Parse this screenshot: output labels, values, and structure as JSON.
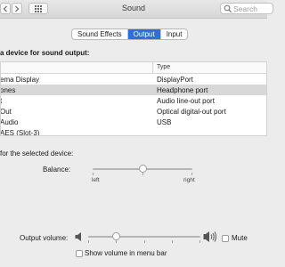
{
  "window": {
    "title": "Sound"
  },
  "search": {
    "placeholder": "Search"
  },
  "tabs": [
    {
      "label": "Sound Effects",
      "active": false
    },
    {
      "label": "Output",
      "active": true
    },
    {
      "label": "Input",
      "active": false
    }
  ],
  "device_section": {
    "label": "a device for sound output:"
  },
  "table": {
    "type_header": "Type",
    "rows": [
      {
        "name": "ema Display",
        "type": "DisplayPort"
      },
      {
        "name": "ones",
        "type": "Headphone port",
        "selected": true
      },
      {
        "name": "t",
        "type": "Audio line-out port"
      },
      {
        "name": "Out",
        "type": "Optical digital-out port"
      },
      {
        "name": "Audio",
        "type": "USB"
      },
      {
        "name": "AES (Slot-3)",
        "type": ""
      }
    ]
  },
  "settings": {
    "label": "for the selected device:"
  },
  "balance": {
    "label": "Balance:",
    "left_label": "left",
    "right_label": "right",
    "value": 0.5
  },
  "output_volume": {
    "label": "Output volume:",
    "value": 0.25
  },
  "mute": {
    "label": "Mute",
    "checked": false
  },
  "menubar": {
    "label": "Show volume in menu bar",
    "checked": false
  },
  "colors": {
    "accent": "#2f6fda",
    "window_bg": "#ececec",
    "selected_row": "#d8d8d8"
  }
}
